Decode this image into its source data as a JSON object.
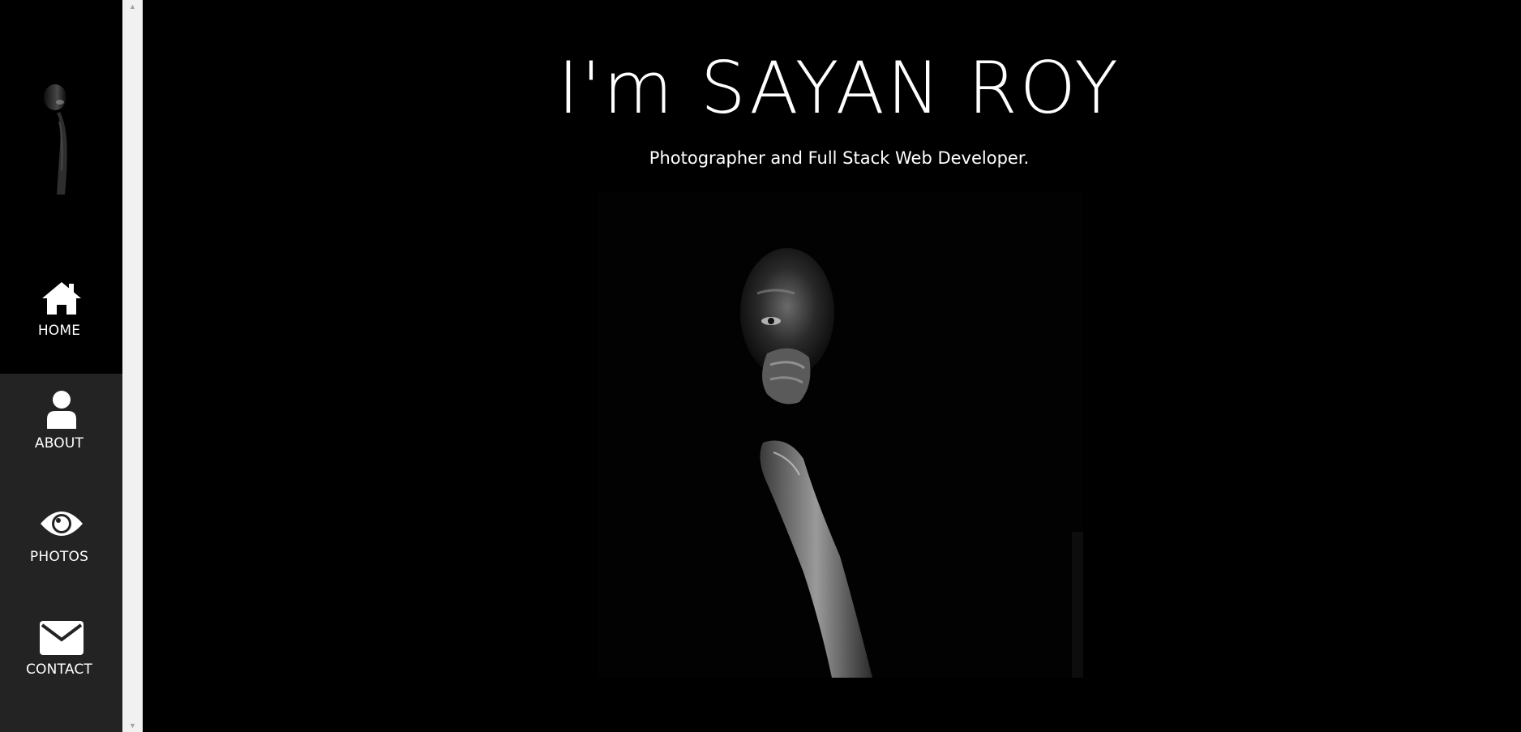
{
  "sidebar": {
    "items": [
      {
        "label": "HOME",
        "icon": "home-icon"
      },
      {
        "label": "ABOUT",
        "icon": "user-icon"
      },
      {
        "label": "PHOTOS",
        "icon": "eye-icon"
      },
      {
        "label": "CONTACT",
        "icon": "envelope-icon"
      }
    ],
    "active": "HOME"
  },
  "hero": {
    "title": "I'm SAYAN ROY",
    "subtitle": "Photographer and Full Stack Web Developer."
  },
  "colors": {
    "background": "#000000",
    "sidebar_lower": "#232323",
    "text": "#ffffff",
    "scrollbar_track": "#f1f1f1"
  }
}
